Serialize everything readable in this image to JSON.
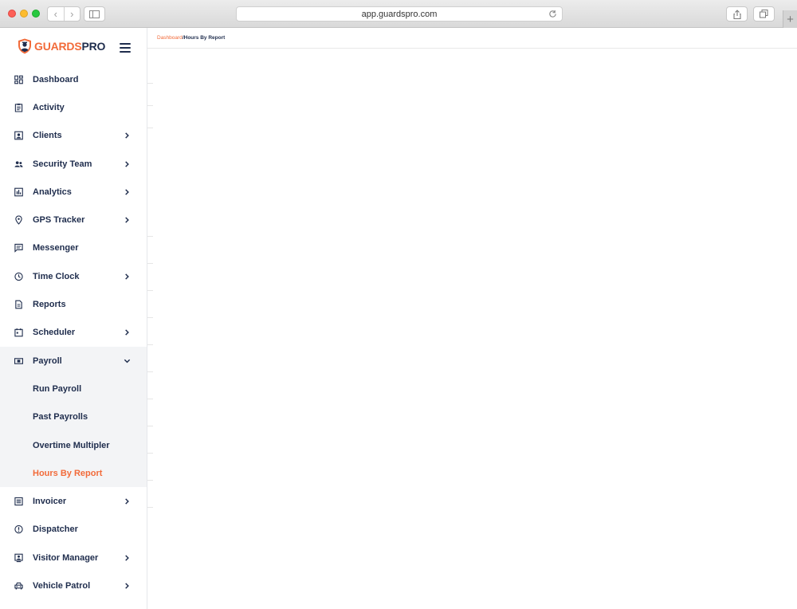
{
  "browser": {
    "url": "app.guardspro.com"
  },
  "logo": {
    "part1": "GUARDS",
    "part2": "PRO"
  },
  "menu": [
    {
      "label": "Dashboard",
      "icon": "dashboard-icon",
      "chevron": false
    },
    {
      "label": "Activity",
      "icon": "clipboard-icon",
      "chevron": false
    },
    {
      "label": "Clients",
      "icon": "client-card-icon",
      "chevron": true
    },
    {
      "label": "Security Team",
      "icon": "team-icon",
      "chevron": true
    },
    {
      "label": "Analytics",
      "icon": "analytics-icon",
      "chevron": true
    },
    {
      "label": "GPS Tracker",
      "icon": "location-pin-icon",
      "chevron": true
    },
    {
      "label": "Messenger",
      "icon": "chat-icon",
      "chevron": false
    },
    {
      "label": "Time Clock",
      "icon": "clock-icon",
      "chevron": true
    },
    {
      "label": "Reports",
      "icon": "document-icon",
      "chevron": false
    },
    {
      "label": "Scheduler",
      "icon": "calendar-icon",
      "chevron": true
    }
  ],
  "payroll": {
    "label": "Payroll",
    "icon": "money-icon",
    "submenu": [
      "Run Payroll",
      "Past Payrolls",
      "Overtime Multipler",
      "Hours By Report"
    ],
    "active": "Hours By Report"
  },
  "menu_bottom": [
    {
      "label": "Invoicer",
      "icon": "invoice-icon",
      "chevron": true
    },
    {
      "label": "Dispatcher",
      "icon": "dispatch-icon",
      "chevron": false
    },
    {
      "label": "Visitor Manager",
      "icon": "visitor-icon",
      "chevron": true
    },
    {
      "label": "Vehicle Patrol",
      "icon": "car-icon",
      "chevron": true
    }
  ],
  "breadcrumb": {
    "link": "Dashboard",
    "separator": "/",
    "current": "Hours By Report"
  },
  "colors": {
    "accent": "#f26b3a",
    "navy": "#1f2d4d"
  }
}
